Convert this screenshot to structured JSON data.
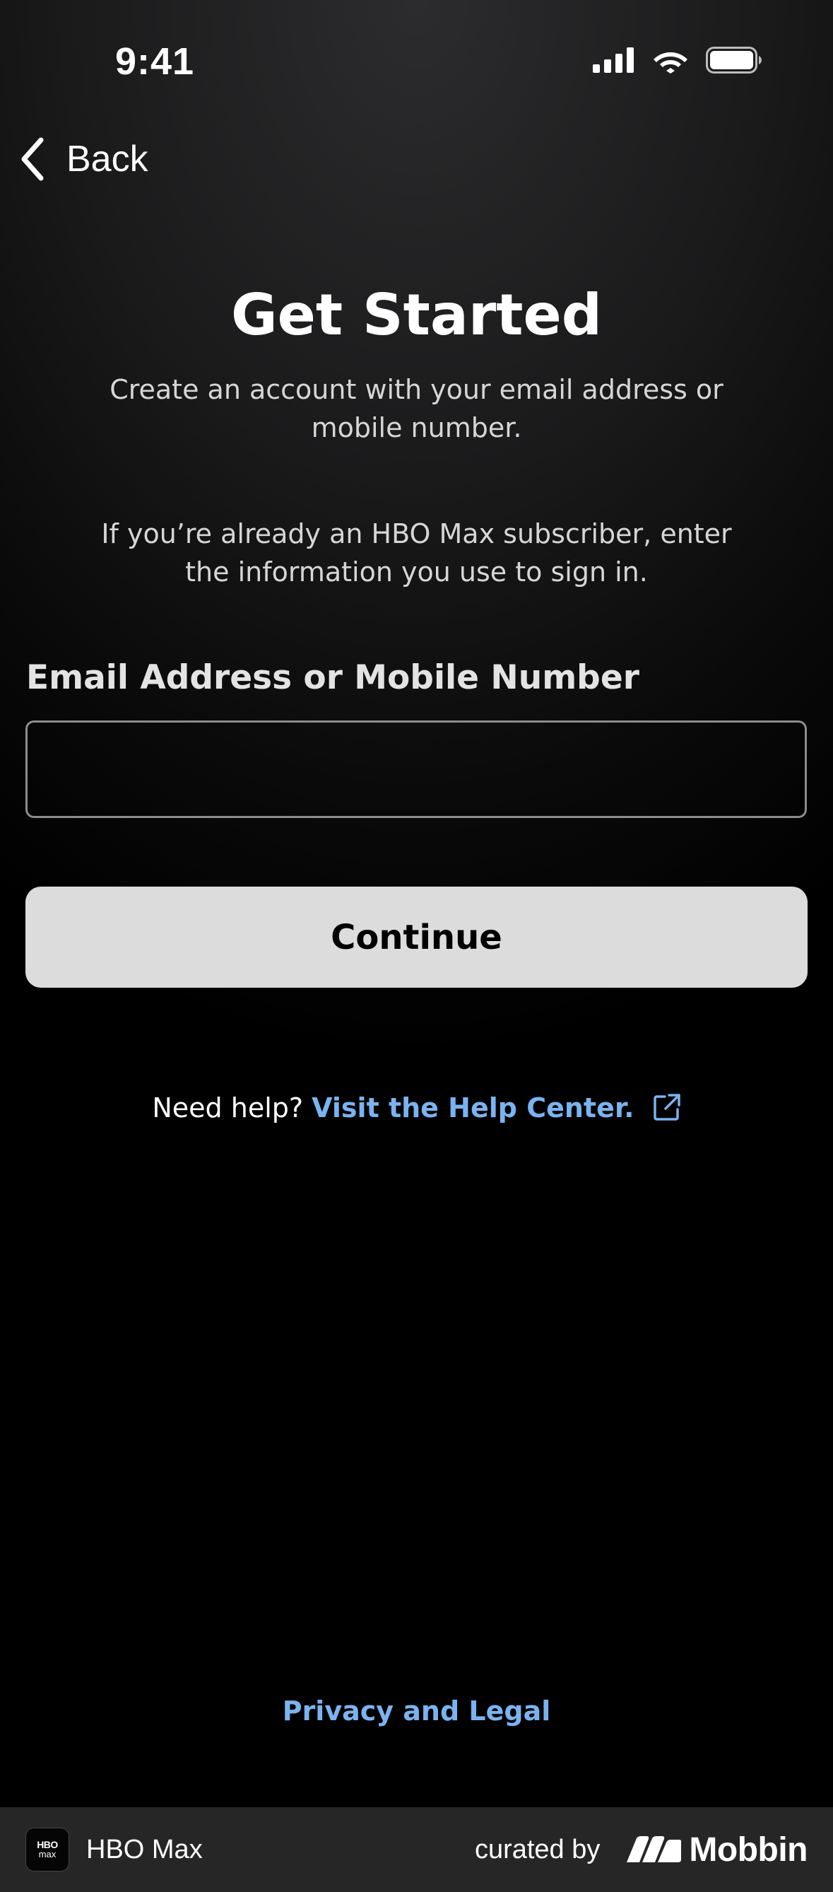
{
  "status_bar": {
    "time": "9:41",
    "icons": [
      "cellular-signal-icon",
      "wifi-icon",
      "battery-icon"
    ]
  },
  "nav": {
    "back_label": "Back",
    "back_icon": "chevron-left-icon"
  },
  "header": {
    "title": "Get Started",
    "subtitle": "Create an account with your email address or mobile number.",
    "info": "If you’re already an HBO Max subscriber, enter the information you use to sign in."
  },
  "form": {
    "field_label": "Email Address or Mobile Number",
    "field_value": "",
    "continue_label": "Continue"
  },
  "help": {
    "prefix": "Need help?",
    "link_label": "Visit the Help Center.",
    "link_icon": "external-link-icon"
  },
  "legal": {
    "privacy_label": "Privacy and Legal"
  },
  "footer": {
    "app_logo_line1": "HBO",
    "app_logo_line2": "max",
    "app_name": "HBO Max",
    "curated_by": "curated by",
    "brand": "Mobbin"
  },
  "colors": {
    "link": "#7ab3f0",
    "button_bg": "#dcdcdc",
    "field_border": "#8c8c8c",
    "footer_bg": "#262626"
  }
}
